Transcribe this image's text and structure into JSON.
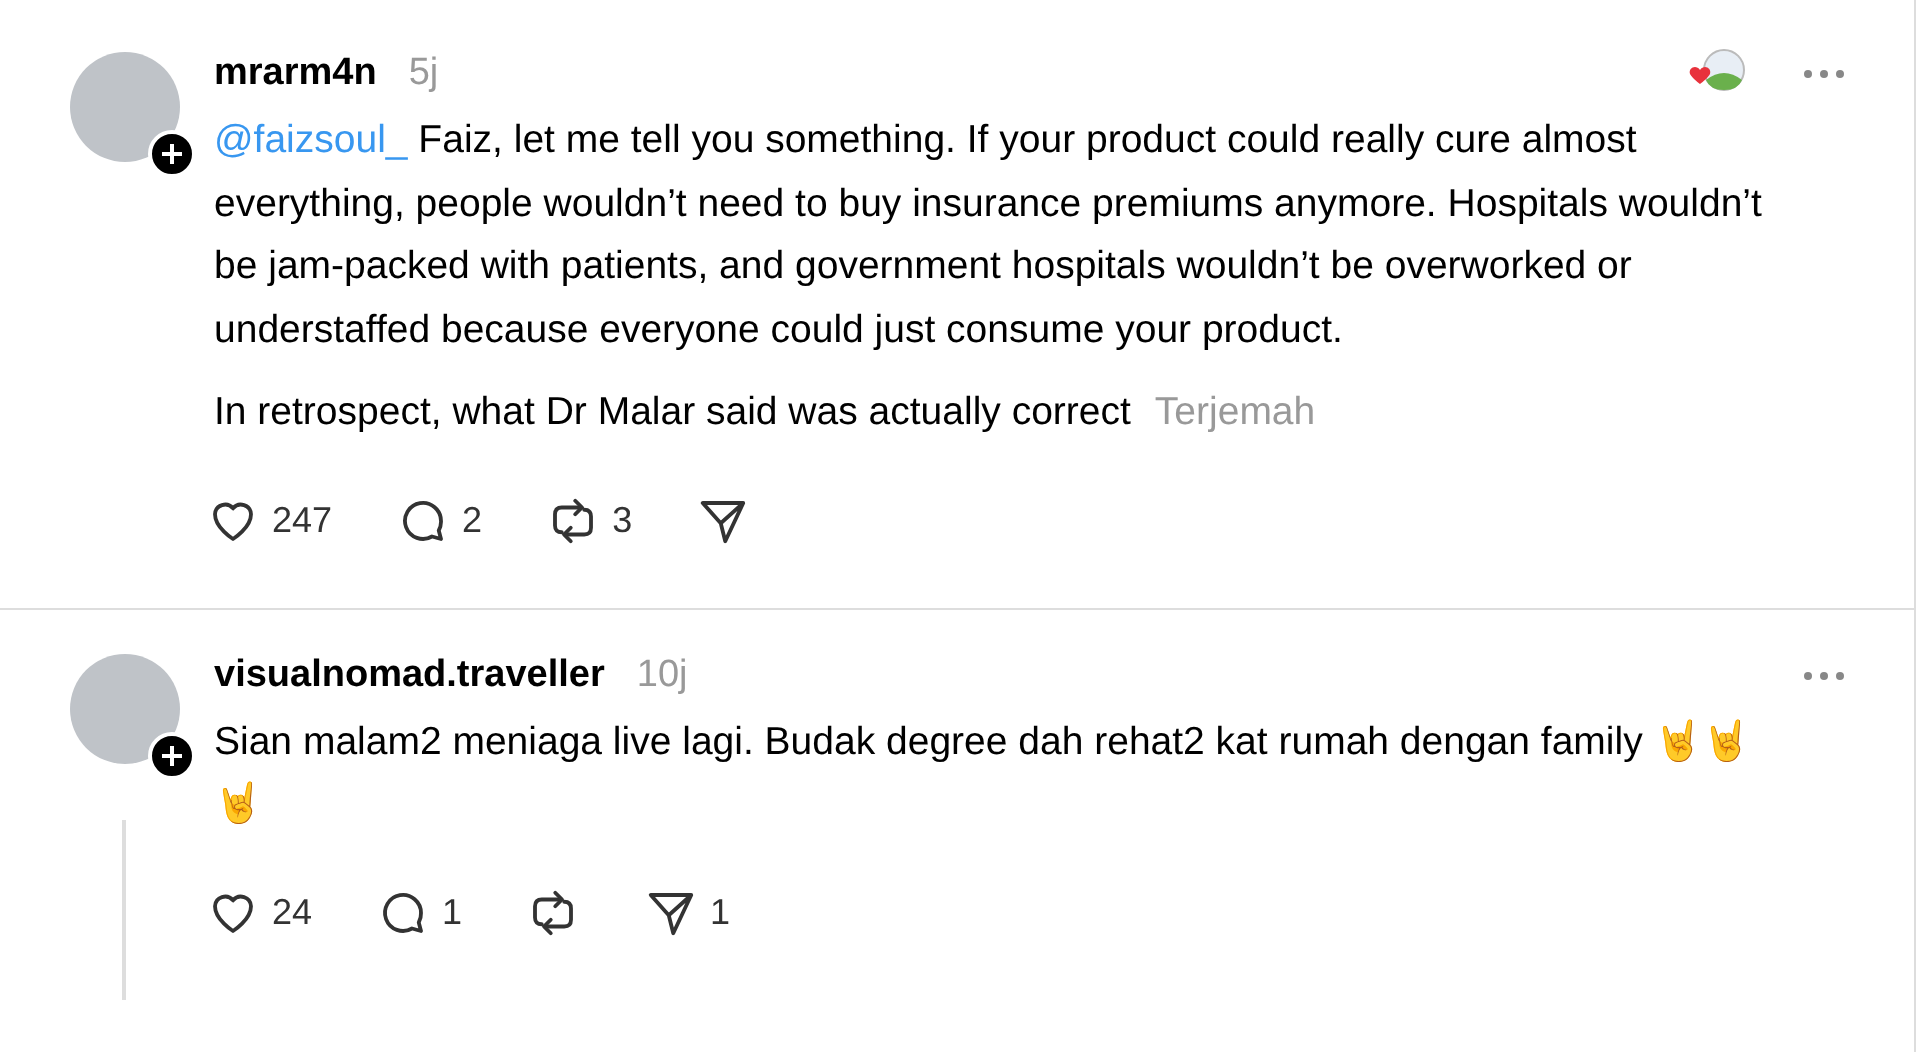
{
  "posts": [
    {
      "username": "mrarm4n",
      "time": "5j",
      "reaction_icon": true,
      "paragraphs": [
        {
          "mention": "@faizsoul_",
          "text": " Faiz, let me tell you something. If your product could really cure almost everything, people wouldn’t need to buy insurance premiums anymore. Hospitals wouldn’t be jam-packed with patients, and government hospitals wouldn’t be overworked or understaffed because everyone could just consume your product."
        },
        {
          "text": "In retrospect, what Dr Malar said was actually correct",
          "translate": "Terjemah"
        }
      ],
      "likes": "247",
      "replies": "2",
      "reposts": "3",
      "thread_line": false
    },
    {
      "username": "visualnomad.traveller",
      "time": "10j",
      "reaction_icon": false,
      "paragraphs": [
        {
          "text": "Sian malam2 meniaga live lagi. Budak degree dah rehat2 kat rumah dengan family 🤘🤘🤘"
        }
      ],
      "likes": "24",
      "replies": "1",
      "shares": "1",
      "thread_line": true
    }
  ]
}
